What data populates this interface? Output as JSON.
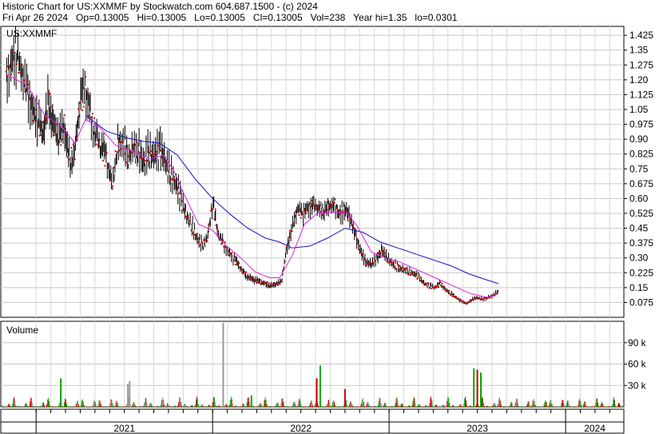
{
  "header": {
    "line1": "Historic Chart for US:XXMMF by Stockwatch.com 604.687.1500 - (c) 2024",
    "line2": "Fri Apr 26 2024   Op=0.13005   Hi=0.13005   Lo=0.13005   Cl=0.13005   Vol=238   Year hi=1.35   lo=0.0301"
  },
  "chart_data": [
    {
      "type": "line",
      "panel": "price",
      "title": "US:XXMMF",
      "y_ticks": [
        "1.425",
        "1.35",
        "1.275",
        "1.20",
        "1.125",
        "1.05",
        "0.975",
        "0.90",
        "0.825",
        "0.75",
        "0.675",
        "0.60",
        "0.525",
        "0.45",
        "0.375",
        "0.30",
        "0.225",
        "0.15",
        "0.075"
      ],
      "ylim": [
        0.0,
        1.47
      ],
      "x_ticks": [
        "2021",
        "2022",
        "2023",
        "2024"
      ],
      "grid": true,
      "colors": {
        "price_bar": "#000000",
        "price_dot": "#cc0000",
        "ma_short": "#e020e0",
        "ma_long": "#1010c0"
      },
      "ohlc_note": "approximate daily price path (close values) read from chart",
      "close_path": [
        [
          2020.83,
          1.2
        ],
        [
          2020.86,
          1.28
        ],
        [
          2020.89,
          1.33
        ],
        [
          2020.92,
          1.22
        ],
        [
          2020.95,
          1.15
        ],
        [
          2020.98,
          1.05
        ],
        [
          2021.01,
          1.0
        ],
        [
          2021.04,
          0.93
        ],
        [
          2021.07,
          1.1
        ],
        [
          2021.1,
          0.98
        ],
        [
          2021.13,
          0.92
        ],
        [
          2021.16,
          0.96
        ],
        [
          2021.19,
          0.78
        ],
        [
          2021.22,
          0.85
        ],
        [
          2021.25,
          1.1
        ],
        [
          2021.28,
          1.15
        ],
        [
          2021.31,
          1.0
        ],
        [
          2021.34,
          0.92
        ],
        [
          2021.37,
          0.85
        ],
        [
          2021.4,
          0.8
        ],
        [
          2021.43,
          0.66
        ],
        [
          2021.46,
          0.86
        ],
        [
          2021.49,
          0.88
        ],
        [
          2021.52,
          0.8
        ],
        [
          2021.55,
          0.86
        ],
        [
          2021.58,
          0.84
        ],
        [
          2021.61,
          0.78
        ],
        [
          2021.64,
          0.84
        ],
        [
          2021.67,
          0.82
        ],
        [
          2021.7,
          0.86
        ],
        [
          2021.73,
          0.8
        ],
        [
          2021.76,
          0.72
        ],
        [
          2021.79,
          0.68
        ],
        [
          2021.82,
          0.6
        ],
        [
          2021.85,
          0.52
        ],
        [
          2021.88,
          0.46
        ],
        [
          2021.91,
          0.4
        ],
        [
          2021.94,
          0.36
        ],
        [
          2021.97,
          0.4
        ],
        [
          2022.0,
          0.58
        ],
        [
          2022.03,
          0.42
        ],
        [
          2022.06,
          0.37
        ],
        [
          2022.09,
          0.33
        ],
        [
          2022.12,
          0.3
        ],
        [
          2022.15,
          0.26
        ],
        [
          2022.18,
          0.22
        ],
        [
          2022.21,
          0.2
        ],
        [
          2022.24,
          0.19
        ],
        [
          2022.27,
          0.18
        ],
        [
          2022.3,
          0.17
        ],
        [
          2022.33,
          0.16
        ],
        [
          2022.36,
          0.17
        ],
        [
          2022.39,
          0.18
        ],
        [
          2022.42,
          0.35
        ],
        [
          2022.45,
          0.45
        ],
        [
          2022.48,
          0.55
        ],
        [
          2022.51,
          0.52
        ],
        [
          2022.54,
          0.55
        ],
        [
          2022.57,
          0.57
        ],
        [
          2022.6,
          0.55
        ],
        [
          2022.63,
          0.53
        ],
        [
          2022.66,
          0.56
        ],
        [
          2022.69,
          0.57
        ],
        [
          2022.72,
          0.52
        ],
        [
          2022.75,
          0.55
        ],
        [
          2022.78,
          0.5
        ],
        [
          2022.81,
          0.42
        ],
        [
          2022.84,
          0.33
        ],
        [
          2022.87,
          0.28
        ],
        [
          2022.9,
          0.27
        ],
        [
          2022.93,
          0.3
        ],
        [
          2022.96,
          0.34
        ],
        [
          2022.99,
          0.3
        ],
        [
          2023.02,
          0.27
        ],
        [
          2023.05,
          0.25
        ],
        [
          2023.08,
          0.24
        ],
        [
          2023.11,
          0.23
        ],
        [
          2023.14,
          0.22
        ],
        [
          2023.17,
          0.2
        ],
        [
          2023.2,
          0.17
        ],
        [
          2023.23,
          0.16
        ],
        [
          2023.26,
          0.15
        ],
        [
          2023.29,
          0.17
        ],
        [
          2023.32,
          0.14
        ],
        [
          2023.35,
          0.12
        ],
        [
          2023.38,
          0.1
        ],
        [
          2023.41,
          0.08
        ],
        [
          2023.44,
          0.07
        ],
        [
          2023.47,
          0.09
        ],
        [
          2023.5,
          0.1
        ],
        [
          2023.53,
          0.09
        ],
        [
          2023.56,
          0.1
        ],
        [
          2023.59,
          0.11
        ],
        [
          2023.62,
          0.13
        ]
      ],
      "ma_short": [
        [
          2020.83,
          1.23
        ],
        [
          2020.95,
          1.17
        ],
        [
          2021.05,
          1.02
        ],
        [
          2021.15,
          0.96
        ],
        [
          2021.22,
          0.88
        ],
        [
          2021.28,
          1.0
        ],
        [
          2021.36,
          0.96
        ],
        [
          2021.45,
          0.87
        ],
        [
          2021.55,
          0.84
        ],
        [
          2021.65,
          0.8
        ],
        [
          2021.72,
          0.82
        ],
        [
          2021.78,
          0.74
        ],
        [
          2021.85,
          0.6
        ],
        [
          2021.92,
          0.47
        ],
        [
          2022.0,
          0.44
        ],
        [
          2022.08,
          0.36
        ],
        [
          2022.16,
          0.3
        ],
        [
          2022.24,
          0.23
        ],
        [
          2022.32,
          0.2
        ],
        [
          2022.38,
          0.2
        ],
        [
          2022.45,
          0.31
        ],
        [
          2022.52,
          0.47
        ],
        [
          2022.6,
          0.53
        ],
        [
          2022.7,
          0.53
        ],
        [
          2022.76,
          0.53
        ],
        [
          2022.82,
          0.46
        ],
        [
          2022.9,
          0.33
        ],
        [
          2022.98,
          0.3
        ],
        [
          2023.06,
          0.28
        ],
        [
          2023.16,
          0.24
        ],
        [
          2023.26,
          0.2
        ],
        [
          2023.36,
          0.16
        ],
        [
          2023.46,
          0.12
        ],
        [
          2023.56,
          0.1
        ],
        [
          2023.62,
          0.12
        ]
      ],
      "ma_long": [
        [
          2021.28,
          1.02
        ],
        [
          2021.4,
          0.94
        ],
        [
          2021.5,
          0.91
        ],
        [
          2021.6,
          0.89
        ],
        [
          2021.7,
          0.88
        ],
        [
          2021.8,
          0.82
        ],
        [
          2021.9,
          0.7
        ],
        [
          2022.0,
          0.6
        ],
        [
          2022.1,
          0.52
        ],
        [
          2022.2,
          0.45
        ],
        [
          2022.3,
          0.4
        ],
        [
          2022.38,
          0.38
        ],
        [
          2022.45,
          0.35
        ],
        [
          2022.55,
          0.36
        ],
        [
          2022.65,
          0.4
        ],
        [
          2022.75,
          0.45
        ],
        [
          2022.85,
          0.43
        ],
        [
          2022.95,
          0.38
        ],
        [
          2023.05,
          0.35
        ],
        [
          2023.15,
          0.32
        ],
        [
          2023.25,
          0.29
        ],
        [
          2023.35,
          0.26
        ],
        [
          2023.45,
          0.22
        ],
        [
          2023.55,
          0.19
        ],
        [
          2023.62,
          0.17
        ]
      ]
    },
    {
      "type": "bar",
      "panel": "volume",
      "title": "Volume",
      "y_ticks": [
        "90 k",
        "60 k",
        "30 k"
      ],
      "ylim": [
        0,
        120
      ],
      "unit": "thousand shares",
      "colors": {
        "up": "#00aa00",
        "down": "#cc0000",
        "flat": "#999999"
      },
      "notable_spikes": [
        {
          "x": 2021.14,
          "value": 40,
          "color": "green"
        },
        {
          "x": 2021.52,
          "value": 32,
          "color": "gray"
        },
        {
          "x": 2021.53,
          "value": 36,
          "color": "gray"
        },
        {
          "x": 2022.06,
          "value": 118,
          "color": "gray"
        },
        {
          "x": 2022.22,
          "value": 16,
          "color": "green"
        },
        {
          "x": 2022.59,
          "value": 40,
          "color": "red"
        },
        {
          "x": 2022.61,
          "value": 58,
          "color": "green"
        },
        {
          "x": 2022.75,
          "value": 25,
          "color": "red"
        },
        {
          "x": 2023.48,
          "value": 54,
          "color": "green"
        },
        {
          "x": 2023.5,
          "value": 52,
          "color": "red"
        },
        {
          "x": 2023.52,
          "value": 48,
          "color": "green"
        }
      ]
    }
  ]
}
